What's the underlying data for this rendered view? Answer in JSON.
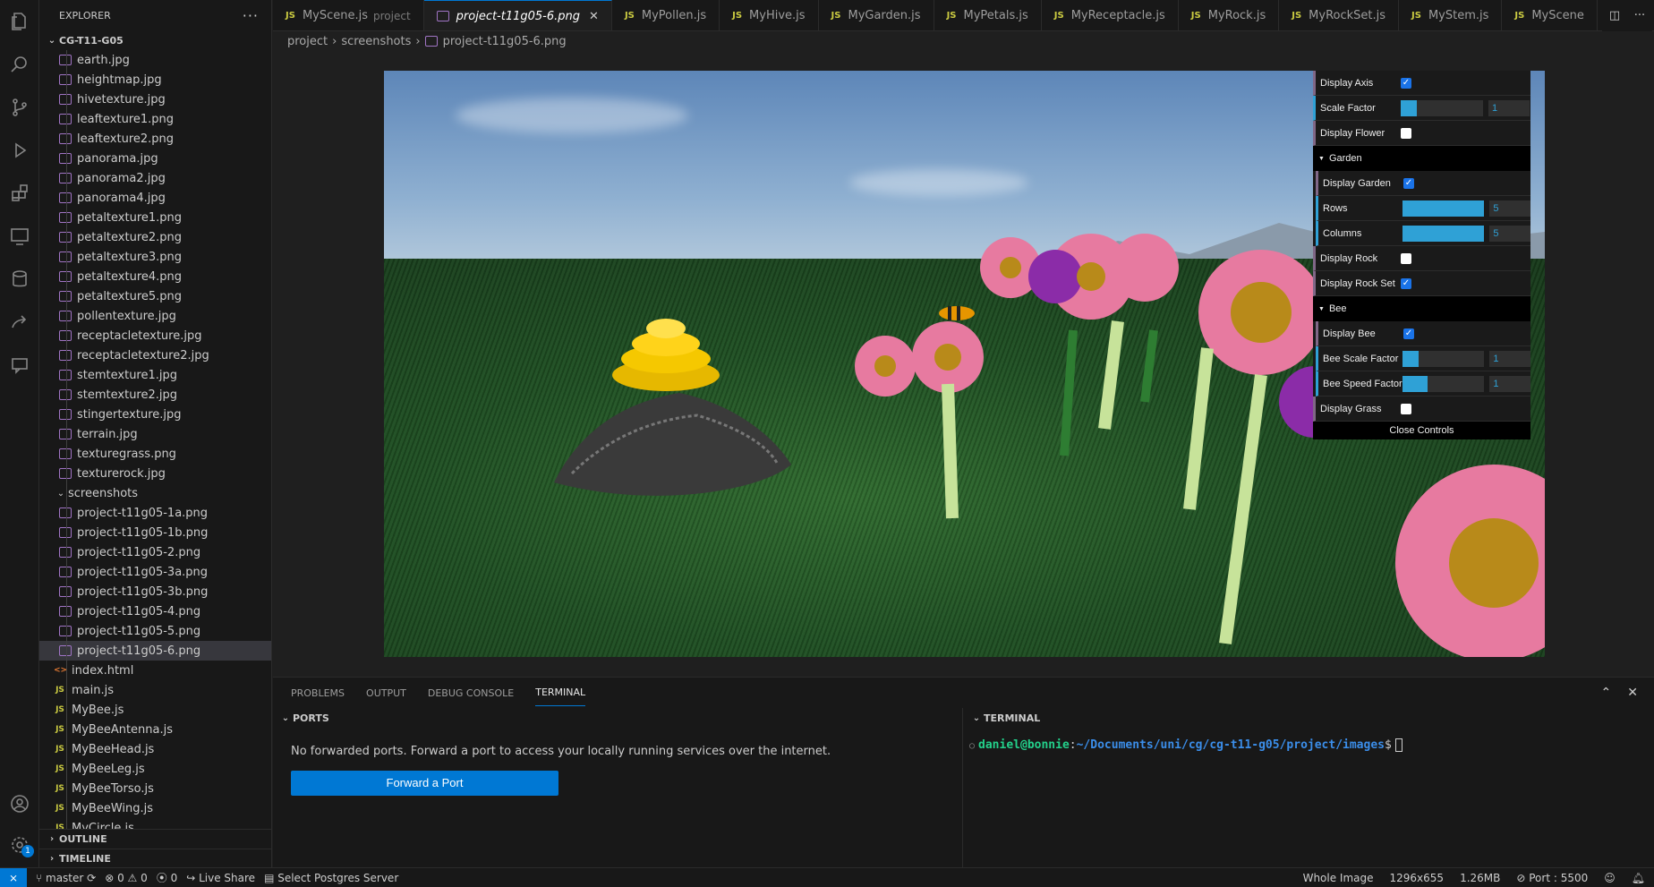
{
  "explorer": {
    "title": "EXPLORER",
    "more": "···",
    "folder": "CG-T11-G05",
    "files_top": [
      {
        "name": "earth.jpg",
        "kind": "img"
      },
      {
        "name": "heightmap.jpg",
        "kind": "img"
      },
      {
        "name": "hivetexture.jpg",
        "kind": "img"
      },
      {
        "name": "leaftexture1.png",
        "kind": "img"
      },
      {
        "name": "leaftexture2.png",
        "kind": "img"
      },
      {
        "name": "panorama.jpg",
        "kind": "img"
      },
      {
        "name": "panorama2.jpg",
        "kind": "img"
      },
      {
        "name": "panorama4.jpg",
        "kind": "img"
      },
      {
        "name": "petaltexture1.png",
        "kind": "img"
      },
      {
        "name": "petaltexture2.png",
        "kind": "img"
      },
      {
        "name": "petaltexture3.png",
        "kind": "img"
      },
      {
        "name": "petaltexture4.png",
        "kind": "img"
      },
      {
        "name": "petaltexture5.png",
        "kind": "img"
      },
      {
        "name": "pollentexture.jpg",
        "kind": "img"
      },
      {
        "name": "receptacletexture.jpg",
        "kind": "img"
      },
      {
        "name": "receptacletexture2.jpg",
        "kind": "img"
      },
      {
        "name": "stemtexture1.jpg",
        "kind": "img"
      },
      {
        "name": "stemtexture2.jpg",
        "kind": "img"
      },
      {
        "name": "stingertexture.jpg",
        "kind": "img"
      },
      {
        "name": "terrain.jpg",
        "kind": "img"
      },
      {
        "name": "texturegrass.png",
        "kind": "img"
      },
      {
        "name": "texturerock.jpg",
        "kind": "img"
      }
    ],
    "screenshots_folder": "screenshots",
    "screenshots": [
      "project-t11g05-1a.png",
      "project-t11g05-1b.png",
      "project-t11g05-2.png",
      "project-t11g05-3a.png",
      "project-t11g05-3b.png",
      "project-t11g05-4.png",
      "project-t11g05-5.png",
      "project-t11g05-6.png"
    ],
    "root_files": [
      {
        "name": "index.html",
        "kind": "html"
      },
      {
        "name": "main.js",
        "kind": "js"
      },
      {
        "name": "MyBee.js",
        "kind": "js"
      },
      {
        "name": "MyBeeAntenna.js",
        "kind": "js"
      },
      {
        "name": "MyBeeHead.js",
        "kind": "js"
      },
      {
        "name": "MyBeeLeg.js",
        "kind": "js"
      },
      {
        "name": "MyBeeTorso.js",
        "kind": "js"
      },
      {
        "name": "MyBeeWing.js",
        "kind": "js"
      },
      {
        "name": "MyCircle.js",
        "kind": "js"
      }
    ],
    "outline": "OUTLINE",
    "timeline": "TIMELINE"
  },
  "tabs": [
    {
      "label": "MyScene.js",
      "extra": "project",
      "kind": "js"
    },
    {
      "label": "project-t11g05-6.png",
      "kind": "img",
      "active": true
    },
    {
      "label": "MyPollen.js",
      "kind": "js"
    },
    {
      "label": "MyHive.js",
      "kind": "js"
    },
    {
      "label": "MyGarden.js",
      "kind": "js"
    },
    {
      "label": "MyPetals.js",
      "kind": "js"
    },
    {
      "label": "MyReceptacle.js",
      "kind": "js"
    },
    {
      "label": "MyRock.js",
      "kind": "js"
    },
    {
      "label": "MyRockSet.js",
      "kind": "js"
    },
    {
      "label": "MyStem.js",
      "kind": "js"
    },
    {
      "label": "MyScene",
      "kind": "js"
    }
  ],
  "breadcrumb": [
    "project",
    "screenshots",
    "project-t11g05-6.png"
  ],
  "gui": {
    "display_axis": {
      "label": "Display Axis",
      "checked": true
    },
    "scale_factor": {
      "label": "Scale Factor",
      "value": "1",
      "fill": 0.2
    },
    "display_flower": {
      "label": "Display Flower",
      "checked": false
    },
    "garden_folder": "Garden",
    "display_garden": {
      "label": "Display Garden",
      "checked": true
    },
    "rows": {
      "label": "Rows",
      "value": "5",
      "fill": 1.0
    },
    "columns": {
      "label": "Columns",
      "value": "5",
      "fill": 1.0
    },
    "display_rock": {
      "label": "Display Rock",
      "checked": false
    },
    "display_rock_set": {
      "label": "Display Rock Set",
      "checked": true
    },
    "bee_folder": "Bee",
    "display_bee": {
      "label": "Display Bee",
      "checked": true
    },
    "bee_scale": {
      "label": "Bee Scale Factor",
      "value": "1",
      "fill": 0.2
    },
    "bee_speed": {
      "label": "Bee Speed Factor",
      "value": "1",
      "fill": 0.3
    },
    "display_grass": {
      "label": "Display Grass",
      "checked": false
    },
    "close": "Close Controls"
  },
  "panel": {
    "tabs": [
      "PROBLEMS",
      "OUTPUT",
      "DEBUG CONSOLE",
      "TERMINAL"
    ],
    "active_tab": "TERMINAL",
    "ports_header": "PORTS",
    "ports_message": "No forwarded ports. Forward a port to access your locally running services over the internet.",
    "forward_button": "Forward a Port",
    "terminal_header": "TERMINAL",
    "terminal_user": "daniel@bonnie",
    "terminal_path": "~/Documents/uni/cg/cg-t11-g05/project/images",
    "terminal_prompt": "$"
  },
  "status": {
    "branch": "master",
    "errors": "0",
    "warnings": "0",
    "ports": "0",
    "live_share": "Live Share",
    "postgres": "Select Postgres Server",
    "whole_image": "Whole Image",
    "dimensions": "1296x655",
    "size": "1.26MB",
    "port": "Port : 5500"
  },
  "colors": {
    "accent": "#0078d4",
    "gui_number": "#2fa1d6",
    "gui_bool": "#806787",
    "js_icon": "#cbcb41",
    "img_icon": "#a074c4",
    "html_icon": "#e37933"
  }
}
